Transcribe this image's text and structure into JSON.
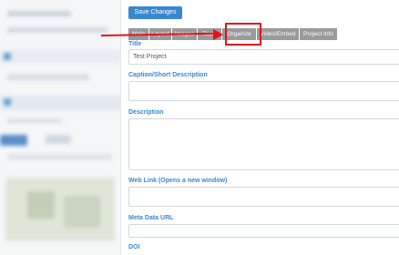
{
  "toolbar": {
    "save_label": "Save Changes"
  },
  "tabs": [
    {
      "label": "Main"
    },
    {
      "label": "Layout"
    },
    {
      "label": "Images"
    },
    {
      "label": "Tools"
    },
    {
      "label": "Organize"
    },
    {
      "label": "Video/Embed"
    },
    {
      "label": "Project Info"
    }
  ],
  "form": {
    "title": {
      "label": "Title",
      "value": "Test Project"
    },
    "caption": {
      "label": "Caption/Short Description",
      "value": ""
    },
    "description": {
      "label": "Description",
      "value": ""
    },
    "web_link": {
      "label": "Web Link (Opens a new window)",
      "value": ""
    },
    "meta_url": {
      "label": "Meta Data URL",
      "value": ""
    },
    "doi": {
      "label": "DOI"
    }
  },
  "colors": {
    "accent": "#3a87d0",
    "highlight": "#e4141b",
    "tab": "#9a9a9a"
  }
}
